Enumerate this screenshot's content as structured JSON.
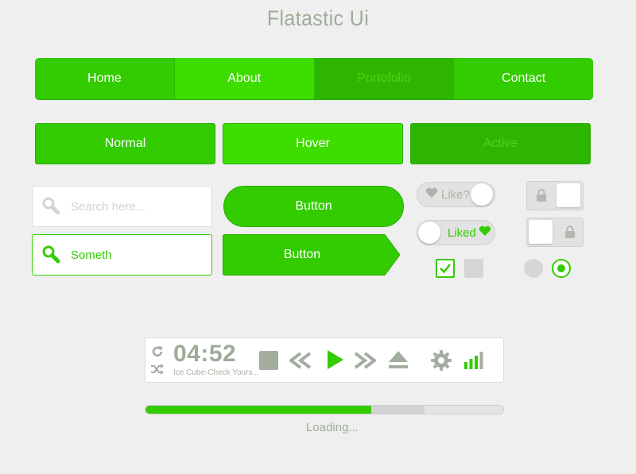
{
  "title": "Flatastic Ui",
  "nav": {
    "items": [
      {
        "label": "Home"
      },
      {
        "label": "About"
      },
      {
        "label": "Portofolio"
      },
      {
        "label": "Contact"
      }
    ]
  },
  "state_buttons": {
    "normal": "Normal",
    "hover": "Hover",
    "active": "Active"
  },
  "search": {
    "placeholder": "Search here...",
    "focused_value": "Someth"
  },
  "buttons": {
    "pill": "Button",
    "arrow": "Button"
  },
  "toggles": {
    "like": "Like?",
    "liked": "Liked"
  },
  "player": {
    "time": "04:52",
    "track": "Ice Cube-Check Yours..."
  },
  "progress": {
    "played_fraction": 0.63,
    "buffered_fraction": 0.78,
    "label": "Loading..."
  },
  "colors": {
    "accent": "#33cc00",
    "hover": "#3ddd00",
    "active": "#2db500",
    "muted": "#9eac98"
  },
  "icons": [
    "search-icon",
    "heart-icon",
    "lock-icon",
    "check-icon",
    "repeat-icon",
    "shuffle-icon",
    "stop-icon",
    "rewind-icon",
    "play-icon",
    "fast-forward-icon",
    "eject-icon",
    "gear-icon",
    "signal-bars-icon"
  ]
}
